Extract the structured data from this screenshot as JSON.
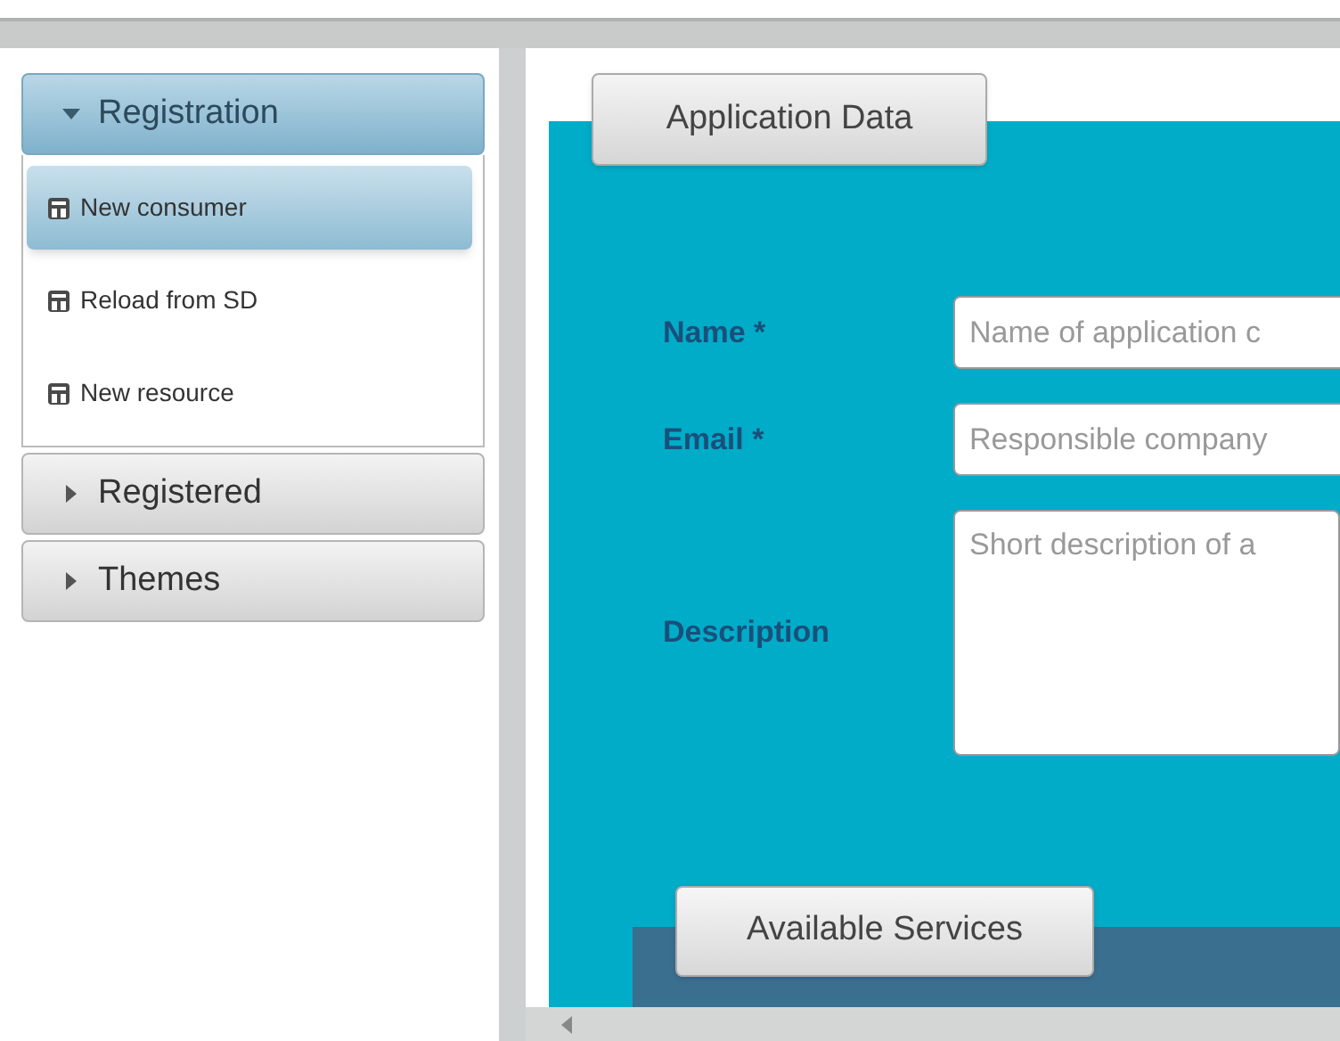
{
  "sidebar": {
    "sections": [
      {
        "label": "Registration",
        "expanded": true,
        "items": [
          {
            "label": "New consumer",
            "selected": true
          },
          {
            "label": "Reload from SD",
            "selected": false
          },
          {
            "label": "New resource",
            "selected": false
          }
        ]
      },
      {
        "label": "Registered",
        "expanded": false
      },
      {
        "label": "Themes",
        "expanded": false
      }
    ]
  },
  "application_data": {
    "legend": "Application Data",
    "fields": [
      {
        "kind": "input",
        "label": "Name *",
        "placeholder": "Name of application c"
      },
      {
        "kind": "input",
        "label": "Email *",
        "placeholder": "Responsible company"
      },
      {
        "kind": "textarea",
        "label": "Description",
        "placeholder": "Short description of a"
      }
    ]
  },
  "available_services": {
    "legend": "Available Services"
  }
}
